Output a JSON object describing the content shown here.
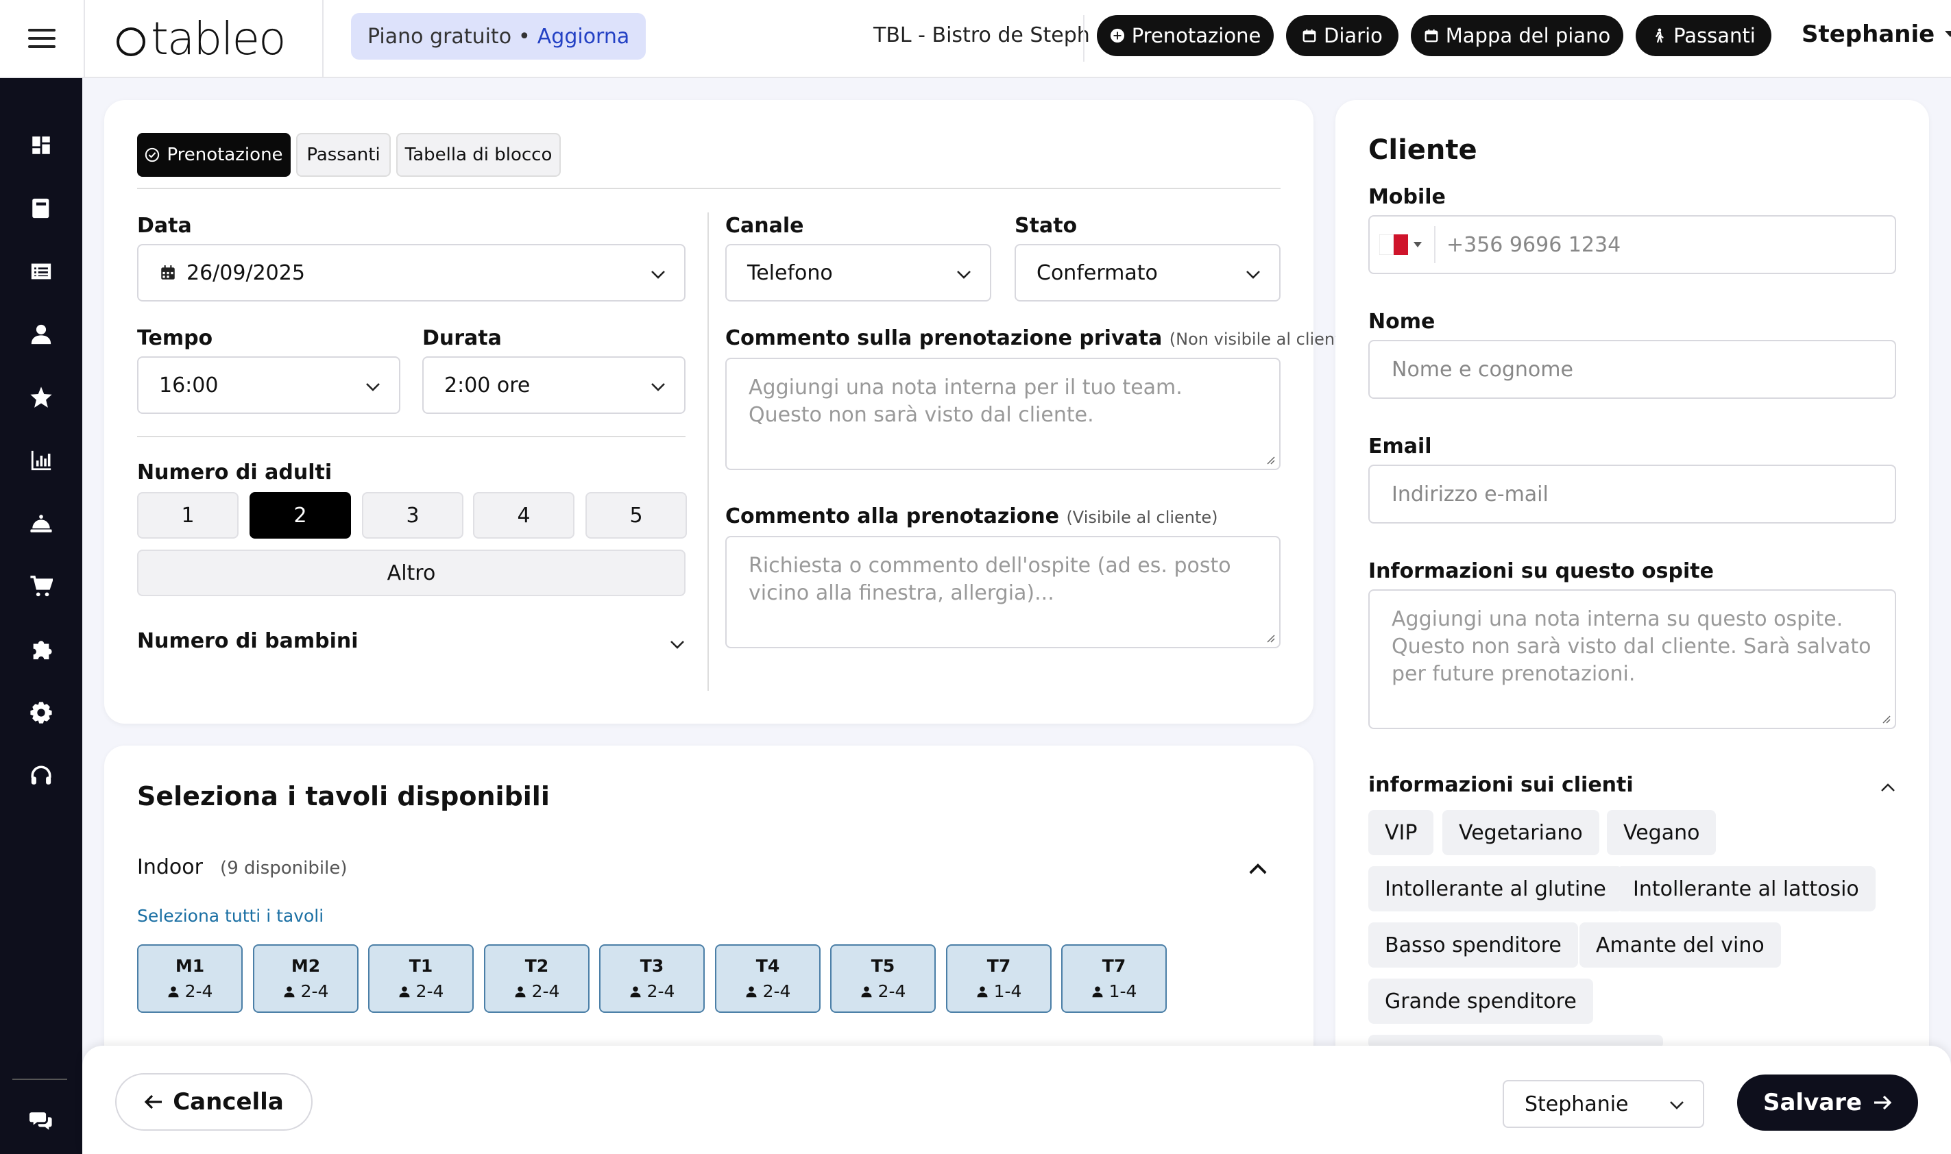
{
  "header": {
    "logo_text": "tableo",
    "plan_label": "Piano gratuito",
    "plan_separator": "•",
    "plan_upgrade": "Aggiorna",
    "restaurant_name": "TBL - Bistro de Steph",
    "actions": [
      {
        "label": "Prenotazione",
        "icon": "plus-circle-icon"
      },
      {
        "label": "Diario",
        "icon": "calendar-icon"
      },
      {
        "label": "Mappa del piano",
        "icon": "calendar-icon"
      },
      {
        "label": "Passanti",
        "icon": "walking-icon"
      }
    ],
    "user_name": "Stephanie"
  },
  "sidebar": {
    "items": [
      "dashboard-icon",
      "book-icon",
      "list-icon",
      "person-icon",
      "star-icon",
      "chart-icon",
      "cloche-icon",
      "cart-icon",
      "puzzle-icon",
      "gear-icon",
      "headset-icon",
      "chat-icon"
    ]
  },
  "booking": {
    "tabs": [
      "Prenotazione",
      "Passanti",
      "Tabella di blocco"
    ],
    "date_label": "Data",
    "date_value": "26/09/2025",
    "time_label": "Tempo",
    "time_value": "16:00",
    "duration_label": "Durata",
    "duration_value": "2:00 ore",
    "adults_label": "Numero di adulti",
    "adults_options": [
      "1",
      "2",
      "3",
      "4",
      "5"
    ],
    "adults_selected": "2",
    "other_label": "Altro",
    "children_label": "Numero di bambini",
    "channel_label": "Canale",
    "channel_value": "Telefono",
    "status_label": "Stato",
    "status_value": "Confermato",
    "private_comment_label": "Commento sulla prenotazione privata",
    "private_comment_hint": "(Non visibile al cliente)",
    "private_comment_placeholder": "Aggiungi una nota interna per il tuo team. Questo non sarà visto dal cliente.",
    "comment_label": "Commento alla prenotazione",
    "comment_hint": "(Visibile al cliente)",
    "comment_placeholder": "Richiesta o commento dell'ospite (ad es. posto vicino alla finestra, allergia)..."
  },
  "tables": {
    "title": "Seleziona i tavoli disponibili",
    "area_name": "Indoor",
    "area_count": "(9 disponibile)",
    "select_all": "Seleziona tutti i tavoli",
    "items": [
      {
        "name": "M1",
        "capacity": "2-4"
      },
      {
        "name": "M2",
        "capacity": "2-4"
      },
      {
        "name": "T1",
        "capacity": "2-4"
      },
      {
        "name": "T2",
        "capacity": "2-4"
      },
      {
        "name": "T3",
        "capacity": "2-4"
      },
      {
        "name": "T4",
        "capacity": "2-4"
      },
      {
        "name": "T5",
        "capacity": "2-4"
      },
      {
        "name": "T7",
        "capacity": "1-4"
      },
      {
        "name": "T7",
        "capacity": "1-4"
      }
    ]
  },
  "client": {
    "title": "Cliente",
    "mobile_label": "Mobile",
    "mobile_placeholder": "+356 9696 1234",
    "name_label": "Nome",
    "name_placeholder": "Nome e cognome",
    "email_label": "Email",
    "email_placeholder": "Indirizzo e-mail",
    "guest_info_label": "Informazioni su questo ospite",
    "guest_info_placeholder": "Aggiungi una nota interna su questo ospite. Questo non sarà visto dal cliente. Sarà salvato per future prenotazioni.",
    "client_info_label": "informazioni sui clienti",
    "tags": [
      "VIP",
      "Vegetariano",
      "Vegano",
      "Intollerante al glutine",
      "Intollerante al lattosio",
      "Basso spenditore",
      "Amante del vino",
      "Grande spenditore"
    ]
  },
  "footer": {
    "cancel_label": "Cancella",
    "staff_value": "Stephanie",
    "save_label": "Salvare"
  },
  "colors": {
    "accent_dark": "#0a0a0a",
    "plan_bg": "#dde2fb",
    "upgrade_link": "#2341c4",
    "table_bg": "#d3e3ef",
    "table_border": "#4b7fa7",
    "select_all_link": "#1a6fa3",
    "sidebar_bg": "#0e0f1c"
  }
}
